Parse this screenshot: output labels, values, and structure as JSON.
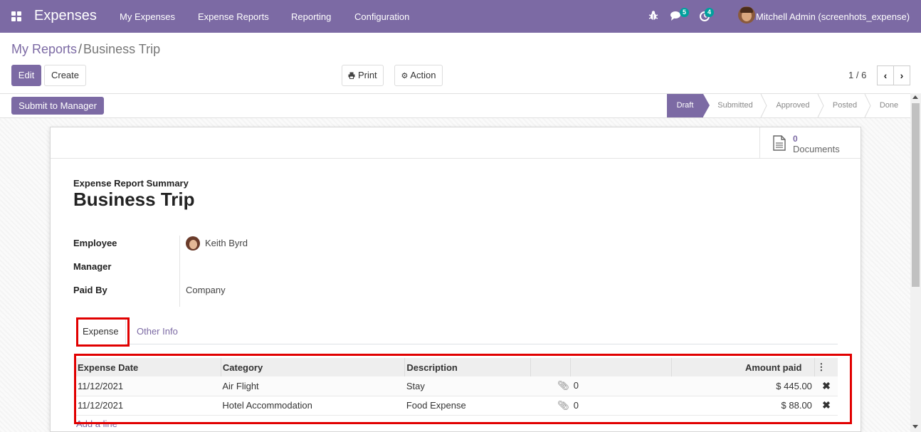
{
  "app": {
    "title": "Expenses"
  },
  "menu": [
    "My Expenses",
    "Expense Reports",
    "Reporting",
    "Configuration"
  ],
  "systray": {
    "messages_count": "5",
    "activities_count": "4",
    "user_name": "Mitchell Admin (screenhots_expense)"
  },
  "breadcrumb": {
    "parent": "My Reports",
    "separator": "/",
    "current": "Business Trip"
  },
  "buttons": {
    "edit": "Edit",
    "create": "Create",
    "print": "Print",
    "action": "Action",
    "submit": "Submit to Manager"
  },
  "pager": {
    "value": "1 / 6"
  },
  "stages": [
    "Draft",
    "Submitted",
    "Approved",
    "Posted",
    "Done"
  ],
  "active_stage": "Draft",
  "documents": {
    "count": "0",
    "label": "Documents"
  },
  "form": {
    "summary_label": "Expense Report Summary",
    "title": "Business Trip",
    "fields": {
      "employee_label": "Employee",
      "employee_value": "Keith Byrd",
      "manager_label": "Manager",
      "paid_by_label": "Paid By",
      "paid_by_value": "Company"
    }
  },
  "tabs": [
    "Expense",
    "Other Info"
  ],
  "table": {
    "columns": [
      "Expense Date",
      "Category",
      "Description",
      "Amount paid"
    ],
    "rows": [
      {
        "date": "11/12/2021",
        "category": "Air Flight",
        "description": "Stay",
        "attachments": "0",
        "amount": "$ 445.00"
      },
      {
        "date": "11/12/2021",
        "category": "Hotel Accommodation",
        "description": "Food Expense",
        "attachments": "0",
        "amount": "$ 88.00"
      }
    ],
    "add_line": "Add a line"
  },
  "colors": {
    "brand": "#7c6aa4",
    "highlight": "#e10000",
    "badge": "#00a09d"
  }
}
